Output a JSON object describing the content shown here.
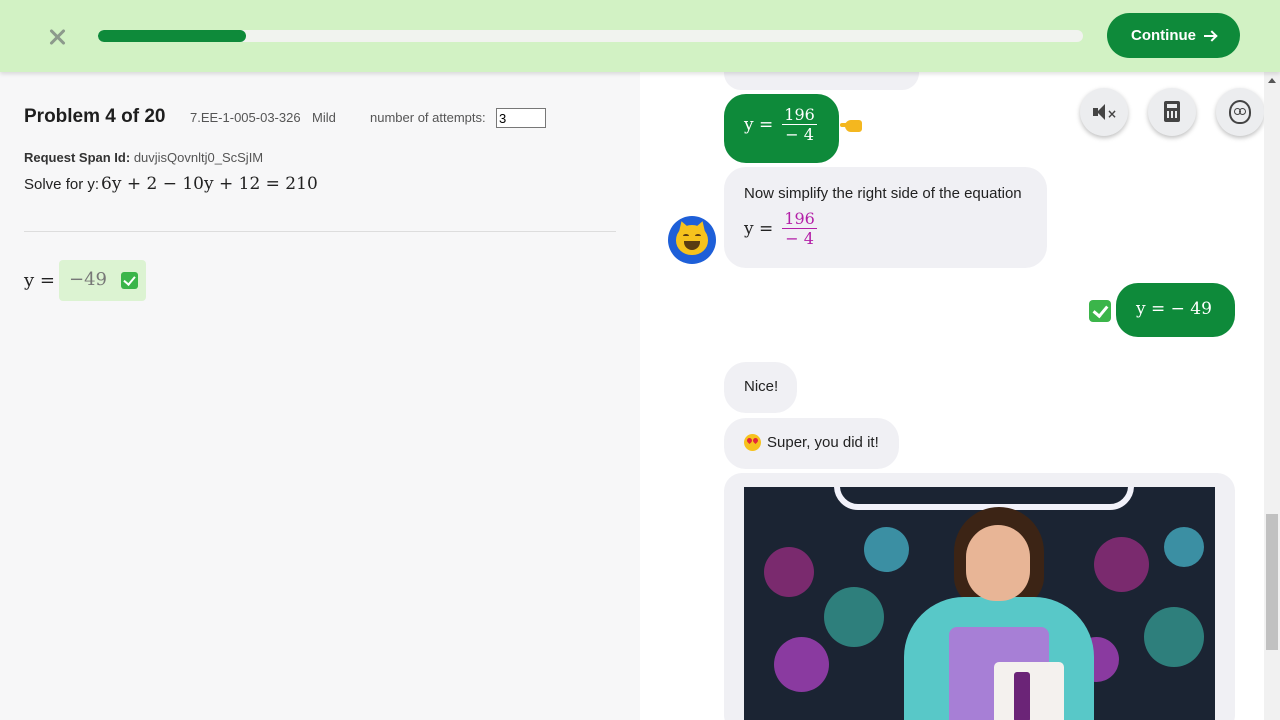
{
  "topbar": {
    "close_label": "×",
    "progress_percent": 15,
    "continue_label": "Continue"
  },
  "problem": {
    "title": "Problem 4 of 20",
    "code": "7.EE-1-005-03-326",
    "difficulty": "Mild",
    "attempts_label": "number of attempts:",
    "attempts_value": "3",
    "span_label": "Request Span Id:",
    "span_value": "duvjisQovnltj0_ScSjIM",
    "solve_label": "Solve for y:",
    "equation": "6y + 2 − 10y + 12 = 210",
    "answer_var": "y =",
    "answer_value": "−49"
  },
  "chat": {
    "messages": [
      {
        "role": "user",
        "lhs": "y =",
        "numerator": "196",
        "denominator": "− 4"
      },
      {
        "role": "tutor",
        "text": "Now simplify the right side of the equation",
        "lhs": "y =",
        "numerator": "196",
        "denominator": "− 4"
      },
      {
        "role": "user",
        "text": "y = − 49"
      },
      {
        "role": "tutor",
        "text": "Nice!"
      },
      {
        "role": "tutor",
        "text": "Super, you did it!"
      }
    ]
  },
  "tools": {
    "mute_icon": "mute-icon",
    "calculator_icon": "calculator-icon",
    "face_icon": "face-icon"
  },
  "colors": {
    "topbar_bg": "#d2f2c4",
    "accent_green": "#0e8a3a",
    "fraction_magenta": "#b31fa7",
    "avatar_blue": "#1e5fd8"
  }
}
